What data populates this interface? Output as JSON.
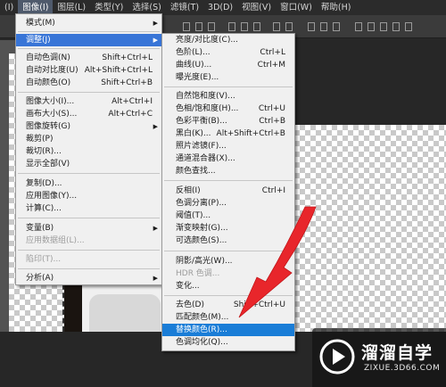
{
  "menubar": {
    "items": [
      "(I)",
      "图像(I)",
      "图层(L)",
      "类型(Y)",
      "选择(S)",
      "滤镜(T)",
      "3D(D)",
      "视图(V)",
      "窗口(W)",
      "帮助(H)"
    ],
    "active_index": 1
  },
  "image_menu": {
    "items": [
      {
        "label": "模式(M)",
        "shortcut": "",
        "submenu": true
      },
      {
        "label": "调整(J)",
        "shortcut": "",
        "submenu": true
      },
      {
        "label": "自动色调(N)",
        "shortcut": "Shift+Ctrl+L"
      },
      {
        "label": "自动对比度(U)",
        "shortcut": "Alt+Shift+Ctrl+L"
      },
      {
        "label": "自动颜色(O)",
        "shortcut": "Shift+Ctrl+B"
      },
      {
        "label": "图像大小(I)...",
        "shortcut": "Alt+Ctrl+I"
      },
      {
        "label": "画布大小(S)...",
        "shortcut": "Alt+Ctrl+C"
      },
      {
        "label": "图像旋转(G)",
        "shortcut": "",
        "submenu": true
      },
      {
        "label": "裁剪(P)",
        "shortcut": ""
      },
      {
        "label": "裁切(R)...",
        "shortcut": ""
      },
      {
        "label": "显示全部(V)",
        "shortcut": ""
      },
      {
        "label": "复制(D)...",
        "shortcut": ""
      },
      {
        "label": "应用图像(Y)...",
        "shortcut": ""
      },
      {
        "label": "计算(C)...",
        "shortcut": ""
      },
      {
        "label": "变量(B)",
        "shortcut": "",
        "submenu": true
      },
      {
        "label": "应用数据组(L)...",
        "shortcut": "",
        "disabled": true
      },
      {
        "label": "陷印(T)...",
        "shortcut": "",
        "disabled": true
      },
      {
        "label": "分析(A)",
        "shortcut": "",
        "submenu": true
      }
    ]
  },
  "adjust_menu": {
    "items": [
      {
        "label": "亮度/对比度(C)...",
        "shortcut": ""
      },
      {
        "label": "色阶(L)...",
        "shortcut": "Ctrl+L"
      },
      {
        "label": "曲线(U)...",
        "shortcut": "Ctrl+M"
      },
      {
        "label": "曝光度(E)...",
        "shortcut": ""
      },
      {
        "label": "自然饱和度(V)...",
        "shortcut": ""
      },
      {
        "label": "色相/饱和度(H)...",
        "shortcut": "Ctrl+U"
      },
      {
        "label": "色彩平衡(B)...",
        "shortcut": "Ctrl+B"
      },
      {
        "label": "黑白(K)...",
        "shortcut": "Alt+Shift+Ctrl+B"
      },
      {
        "label": "照片滤镜(F)...",
        "shortcut": ""
      },
      {
        "label": "通道混合器(X)...",
        "shortcut": ""
      },
      {
        "label": "颜色查找...",
        "shortcut": ""
      },
      {
        "label": "反相(I)",
        "shortcut": "Ctrl+I"
      },
      {
        "label": "色调分离(P)...",
        "shortcut": ""
      },
      {
        "label": "阈值(T)...",
        "shortcut": ""
      },
      {
        "label": "渐变映射(G)...",
        "shortcut": ""
      },
      {
        "label": "可选颜色(S)...",
        "shortcut": ""
      },
      {
        "label": "阴影/高光(W)...",
        "shortcut": ""
      },
      {
        "label": "HDR 色调...",
        "shortcut": "",
        "disabled": true
      },
      {
        "label": "变化...",
        "shortcut": ""
      },
      {
        "label": "去色(D)",
        "shortcut": "Shift+Ctrl+U"
      },
      {
        "label": "匹配颜色(M)...",
        "shortcut": ""
      },
      {
        "label": "替换颜色(R)...",
        "shortcut": "",
        "highlighted": true
      },
      {
        "label": "色调均化(Q)...",
        "shortcut": ""
      }
    ]
  },
  "watermark": {
    "brand": "溜溜自学",
    "url": "ZIXUE.3D66.COM"
  },
  "colors": {
    "highlight": "#1a7dd7",
    "arrow": "#e8262b"
  }
}
